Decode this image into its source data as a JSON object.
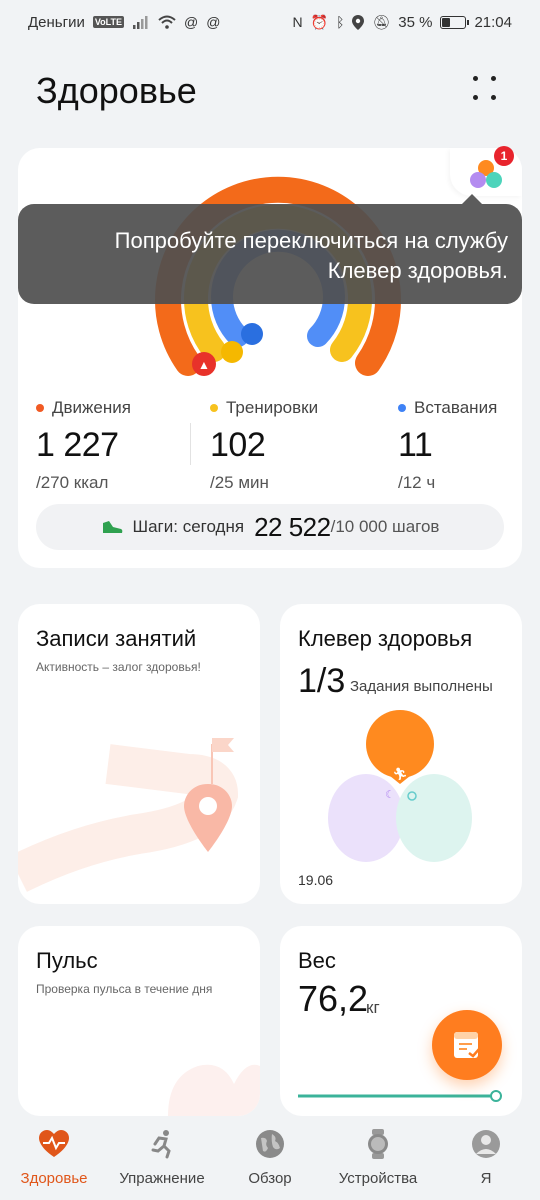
{
  "status_bar": {
    "carrier": "Деньгии",
    "volte": "VoLTE",
    "battery": "35 %",
    "time": "21:04",
    "battery_level": 0.35,
    "icons": [
      "signal-icon",
      "wifi-icon",
      "at-icon",
      "at-icon",
      "nfc-icon",
      "alarm-icon",
      "bluetooth-icon",
      "location-icon",
      "mute-icon",
      "battery-icon"
    ]
  },
  "header": {
    "title": "Здоровье"
  },
  "summary": {
    "tooltip": "Попробуйте переключиться на службу Клевер здоровья.",
    "badge": "1",
    "metrics": [
      {
        "label": "Движения",
        "value": "1 227",
        "goal": "/270 ккал",
        "color": "#f15a24"
      },
      {
        "label": "Тренировки",
        "value": "102",
        "goal": "/25 мин",
        "color": "#f7c21e"
      },
      {
        "label": "Вставания",
        "value": "11",
        "goal": "/12 ч",
        "color": "#3e82f6"
      }
    ],
    "steps": {
      "label": "Шаги: сегодня",
      "value": "22 522",
      "goal": "/10 000 шагов"
    }
  },
  "tiles": {
    "records": {
      "title": "Записи занятий",
      "subtitle": "Активность – залог здоровья!"
    },
    "clover": {
      "title": "Клевер здоровья",
      "count": "1/3",
      "count_label": "Задания выполнены",
      "date": "19.06"
    },
    "pulse": {
      "title": "Пульс",
      "subtitle": "Проверка пульса в течение дня"
    },
    "weight": {
      "title": "Вес",
      "value": "76,2",
      "unit": "кг"
    }
  },
  "nav": {
    "items": [
      {
        "label": "Здоровье",
        "icon": "heart-pulse-icon",
        "active": true
      },
      {
        "label": "Упражнение",
        "icon": "running-icon",
        "active": false
      },
      {
        "label": "Обзор",
        "icon": "globe-icon",
        "active": false
      },
      {
        "label": "Устройства",
        "icon": "watch-icon",
        "active": false
      },
      {
        "label": "Я",
        "icon": "profile-icon",
        "active": false
      }
    ]
  },
  "colors": {
    "accent": "#e0561a",
    "move": "#f15a24",
    "exercise": "#f7c21e",
    "stand": "#3e82f6",
    "fab": "#ff7d1f"
  }
}
